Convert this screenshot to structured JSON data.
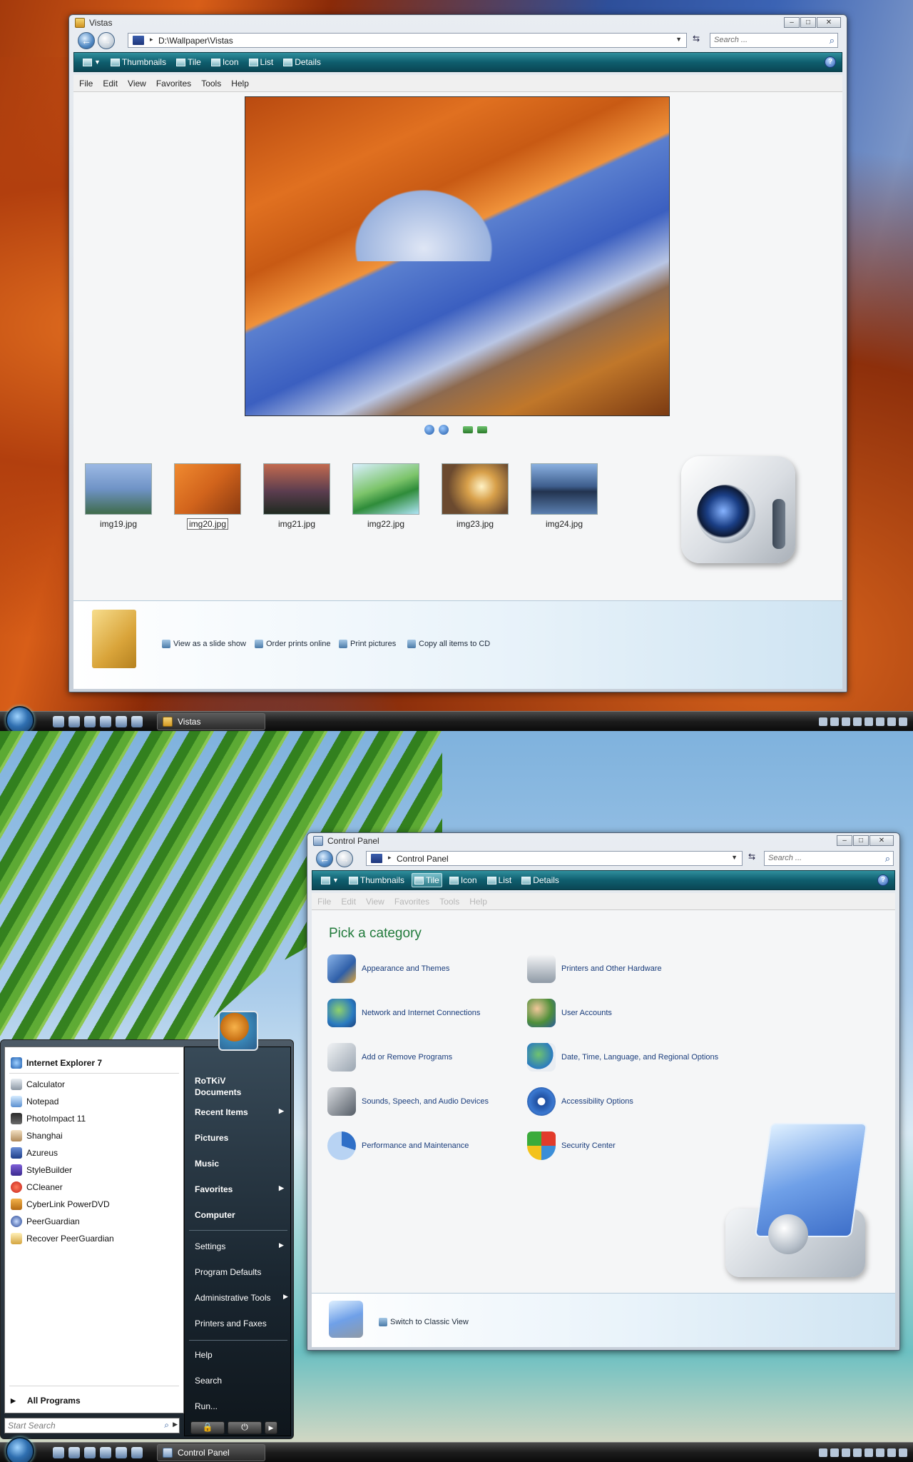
{
  "top": {
    "window": {
      "title": "Vistas",
      "address": "D:\\Wallpaper\\Vistas",
      "search_placeholder": "Search ...",
      "toolbar": [
        "Thumbnails",
        "Tile",
        "Icon",
        "List",
        "Details"
      ],
      "menu": [
        "File",
        "Edit",
        "View",
        "Favorites",
        "Tools",
        "Help"
      ],
      "thumbnails": [
        {
          "label": "img19.jpg",
          "color": "#6f93c6"
        },
        {
          "label": "img20.jpg",
          "color": "#d2641c",
          "selected": true
        },
        {
          "label": "img21.jpg",
          "color": "#5b3d4f"
        },
        {
          "label": "img22.jpg",
          "color": "#7cc46a"
        },
        {
          "label": "img23.jpg",
          "color": "#d8a04a"
        },
        {
          "label": "img24.jpg",
          "color": "#3d5d8c"
        }
      ],
      "tasks": [
        "View as a slide show",
        "Order prints online",
        "Print pictures",
        "Copy all items to CD"
      ]
    },
    "taskbar": {
      "button": "Vistas"
    }
  },
  "bottom": {
    "window": {
      "title": "Control Panel",
      "address": "Control Panel",
      "search_placeholder": "Search ...",
      "toolbar": [
        "Thumbnails",
        "Tile",
        "Icon",
        "List",
        "Details"
      ],
      "menu": [
        "File",
        "Edit",
        "View",
        "Favorites",
        "Tools",
        "Help"
      ],
      "heading": "Pick a category",
      "categories_left": [
        "Appearance and Themes",
        "Network and Internet Connections",
        "Add or Remove Programs",
        "Sounds, Speech, and Audio Devices",
        "Performance and Maintenance"
      ],
      "categories_right": [
        "Printers and Other Hardware",
        "User Accounts",
        "Date, Time, Language, and Regional Options",
        "Accessibility Options",
        "Security Center"
      ],
      "task": "Switch to Classic View"
    },
    "start_menu": {
      "pinned": "Internet Explorer 7",
      "programs": [
        "Calculator",
        "Notepad",
        "PhotoImpact 11",
        "Shanghai",
        "Azureus",
        "StyleBuilder",
        "CCleaner",
        "CyberLink PowerDVD",
        "PeerGuardian",
        "Recover PeerGuardian"
      ],
      "all_programs": "All Programs",
      "search_placeholder": "Start Search",
      "user": "RoTKiV",
      "right": {
        "documents": "Documents",
        "recent": "Recent Items",
        "pictures": "Pictures",
        "music": "Music",
        "favorites": "Favorites",
        "computer": "Computer",
        "settings": "Settings",
        "defaults": "Program Defaults",
        "admin": "Administrative Tools",
        "printers": "Printers and Faxes",
        "help": "Help",
        "search": "Search",
        "run": "Run..."
      }
    },
    "taskbar": {
      "button": "Control Panel"
    }
  }
}
